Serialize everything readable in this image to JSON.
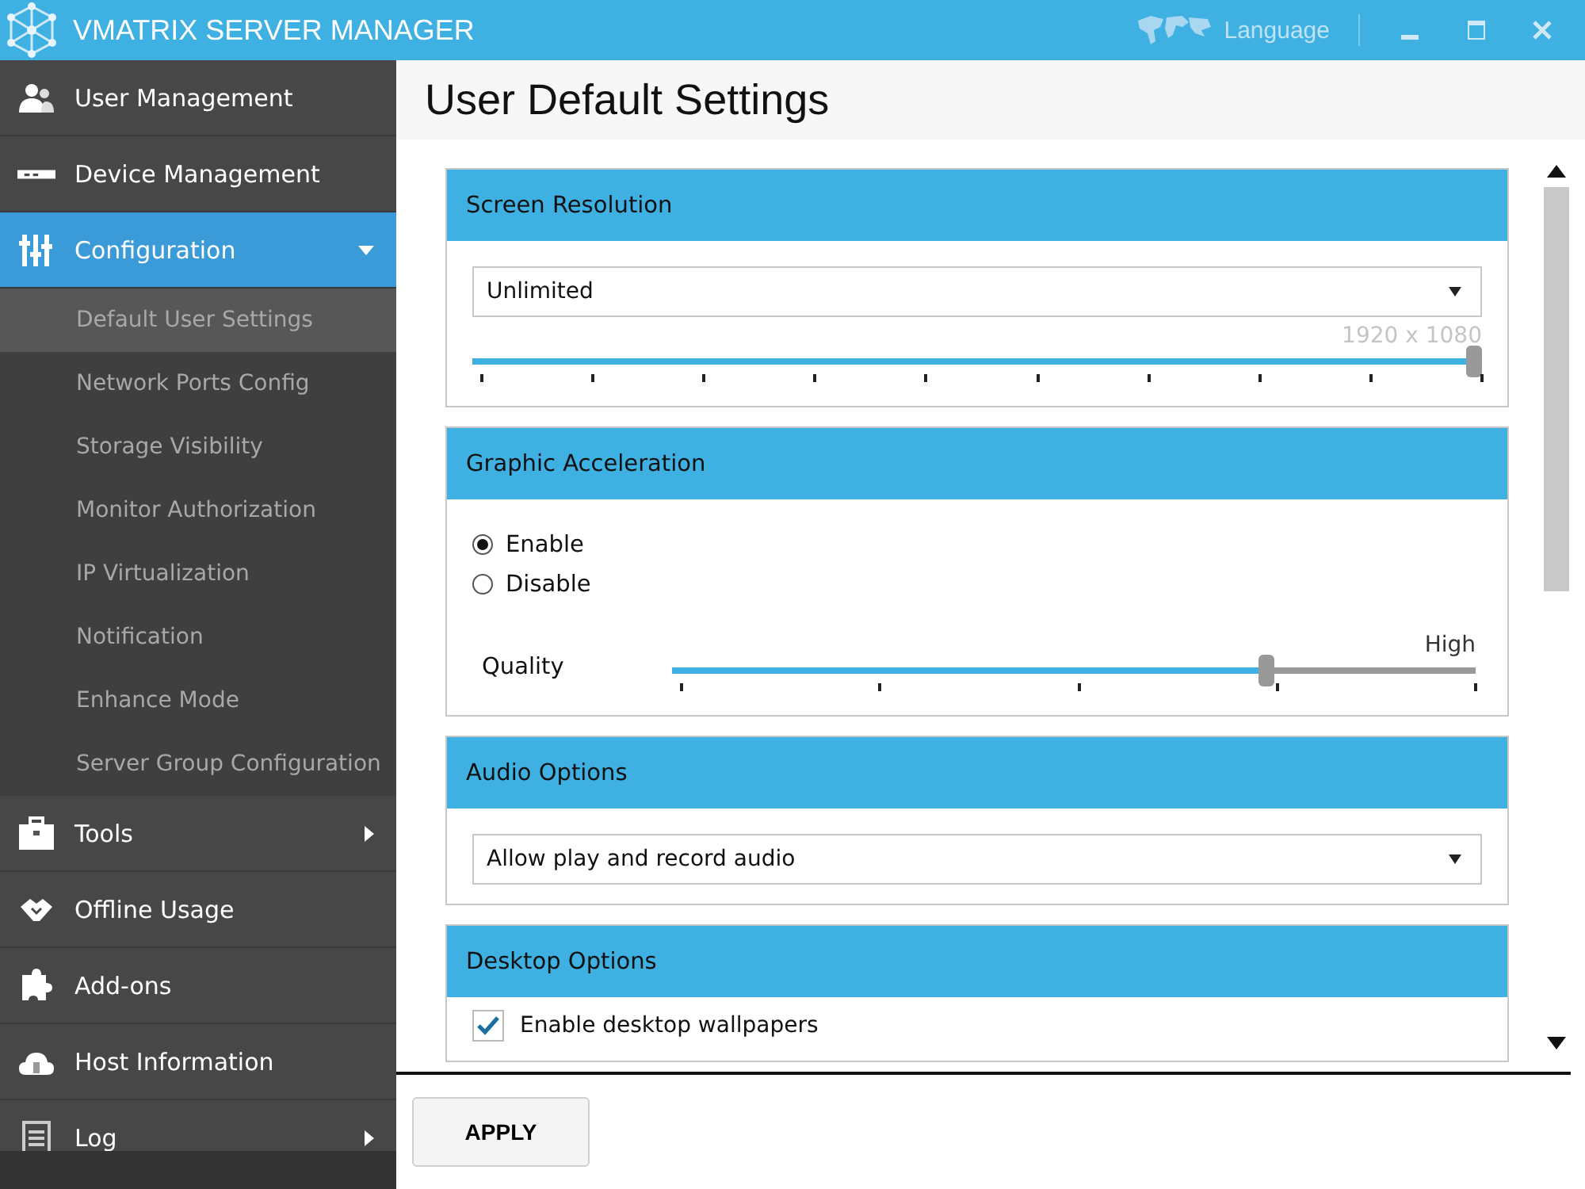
{
  "window": {
    "title": "VMATRIX SERVER MANAGER",
    "language": "Language"
  },
  "sidebar": {
    "items": [
      {
        "label": "User Management",
        "selected": false
      },
      {
        "label": "Device Management",
        "selected": false
      },
      {
        "label": "Configuration",
        "selected": true,
        "expanded": true,
        "children": [
          {
            "label": "Default User Settings",
            "selected": true
          },
          {
            "label": "Network Ports Config",
            "selected": false
          },
          {
            "label": "Storage Visibility",
            "selected": false
          },
          {
            "label": "Monitor Authorization",
            "selected": false
          },
          {
            "label": "IP Virtualization",
            "selected": false
          },
          {
            "label": "Notification",
            "selected": false
          },
          {
            "label": "Enhance Mode",
            "selected": false
          },
          {
            "label": "Server Group Configuration",
            "selected": false
          }
        ]
      },
      {
        "label": "Tools",
        "selected": false,
        "expanded": false
      },
      {
        "label": "Offline Usage",
        "selected": false
      },
      {
        "label": "Add-ons",
        "selected": false
      },
      {
        "label": "Host Information",
        "selected": false
      },
      {
        "label": "Log",
        "selected": false,
        "expanded": false
      }
    ]
  },
  "page": {
    "title": "User Default Settings"
  },
  "sections": [
    {
      "title": "Screen Resolution",
      "items": [
        {
          "kind": "dropdown",
          "value": "Unlimited"
        },
        {
          "kind": "slider",
          "reading": "1920 x 1080",
          "level": 1.0,
          "faded": true
        }
      ]
    },
    {
      "title": "Graphic Acceleration",
      "items": [
        {
          "kind": "radio",
          "label": "Enable",
          "selected": true
        },
        {
          "kind": "radio",
          "label": "Disable",
          "selected": false
        },
        {
          "kind": "labeled-slider",
          "label": "Quality",
          "reading": "High",
          "level": 0.75
        }
      ]
    },
    {
      "title": "Audio Options",
      "items": [
        {
          "kind": "dropdown",
          "value": "Allow play and record audio"
        }
      ]
    },
    {
      "title": "Desktop Options",
      "items": [
        {
          "kind": "checkbox",
          "label": "Enable desktop wallpapers",
          "checked": true
        }
      ]
    }
  ],
  "apply_button": "APPLY"
}
